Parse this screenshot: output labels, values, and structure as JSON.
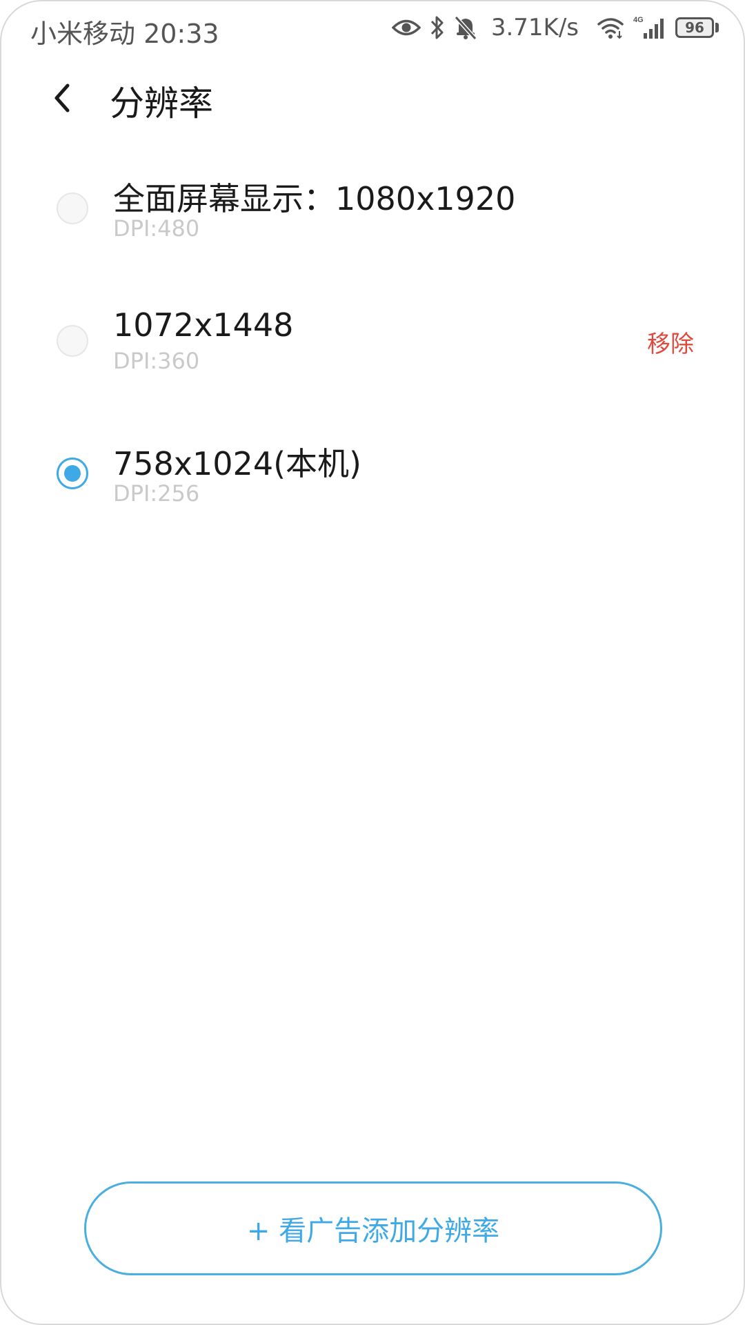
{
  "status_bar": {
    "carrier_time": "小米移动 20:33",
    "net_speed": "3.71K/s",
    "battery_level": "96",
    "icons": [
      "eye-icon",
      "bluetooth-icon",
      "bell-muted-icon",
      "wifi-icon",
      "signal-4g-icon",
      "battery-icon"
    ]
  },
  "header": {
    "back_icon": "chevron-left-icon",
    "title": "分辨率"
  },
  "options": [
    {
      "label": "全面屏幕显示：1080x1920",
      "dpi": "DPI:480",
      "selected": false
    },
    {
      "label": "1072x1448",
      "dpi": "DPI:360",
      "selected": false,
      "action": "移除"
    },
    {
      "label": "758x1024(本机)",
      "dpi": "DPI:256",
      "selected": true
    }
  ],
  "add_button": {
    "label": "+ 看广告添加分辨率"
  },
  "colors": {
    "accent": "#3fa9e6",
    "remove": "#e04a3e",
    "dpi_text": "#c9c9c9"
  }
}
